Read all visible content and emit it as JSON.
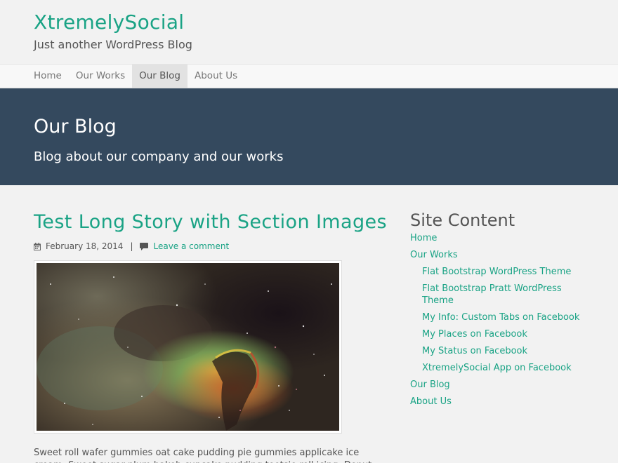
{
  "header": {
    "site_title": "XtremelySocial",
    "site_description": "Just another WordPress Blog"
  },
  "nav": {
    "items": [
      {
        "label": "Home"
      },
      {
        "label": "Our Works"
      },
      {
        "label": "Our Blog",
        "active": true
      },
      {
        "label": "About Us"
      }
    ]
  },
  "banner": {
    "title": "Our Blog",
    "subtitle": "Blog about our company and our works"
  },
  "post": {
    "title": "Test Long Story with Section Images",
    "date": "February 18, 2014",
    "separator": "|",
    "comment_link": "Leave a comment",
    "icons": {
      "date": "calendar-icon",
      "comment": "comment-icon"
    },
    "excerpt": "Sweet roll wafer gummies oat cake pudding pie gummies applicake ice cream. Sweet sugar plum bakeh cupcake pudding tootsie roll icing. Donut carrot cake"
  },
  "sidebar": {
    "title": "Site Content",
    "items": [
      {
        "label": "Home",
        "level": 0
      },
      {
        "label": "Our Works",
        "level": 0
      },
      {
        "label": "Flat Bootstrap WordPress Theme",
        "level": 1
      },
      {
        "label": "Flat Bootstrap Pratt WordPress Theme",
        "level": 1
      },
      {
        "label": "My Info: Custom Tabs on Facebook",
        "level": 1
      },
      {
        "label": "My Places on Facebook",
        "level": 1
      },
      {
        "label": "My Status on Facebook",
        "level": 1
      },
      {
        "label": "XtremelySocial App on Facebook",
        "level": 1
      },
      {
        "label": "Our Blog",
        "level": 0
      },
      {
        "label": "About Us",
        "level": 0
      }
    ]
  },
  "colors": {
    "accent": "#1aa385",
    "banner_bg": "#34495e",
    "page_bg": "#f2f2f2"
  }
}
